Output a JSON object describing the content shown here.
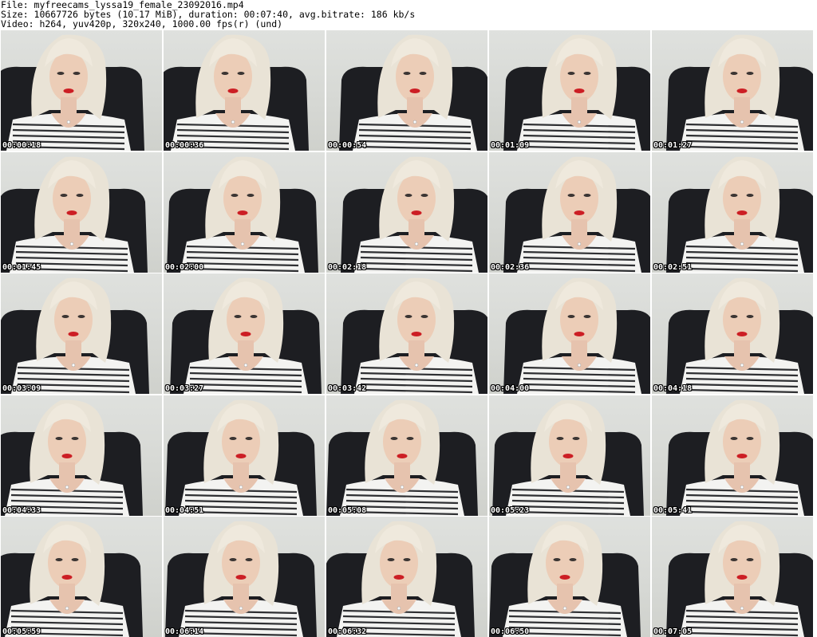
{
  "header": {
    "file_line": "File: myfreecams_lyssa19_female_23092016.mp4",
    "size_line": "Size: 10667726 bytes (10.17 MiB), duration: 00:07:40, avg.bitrate: 186 kb/s",
    "video_line": "Video: h264, yuv420p, 320x240, 1000.00 fps(r) (und)"
  },
  "thumbnails": [
    {
      "timestamp": "00:00:18"
    },
    {
      "timestamp": "00:00:36"
    },
    {
      "timestamp": "00:00:54"
    },
    {
      "timestamp": "00:01:09"
    },
    {
      "timestamp": "00:01:27"
    },
    {
      "timestamp": "00:01:45"
    },
    {
      "timestamp": "00:02:00"
    },
    {
      "timestamp": "00:02:18"
    },
    {
      "timestamp": "00:02:36"
    },
    {
      "timestamp": "00:02:51"
    },
    {
      "timestamp": "00:03:09"
    },
    {
      "timestamp": "00:03:27"
    },
    {
      "timestamp": "00:03:42"
    },
    {
      "timestamp": "00:04:00"
    },
    {
      "timestamp": "00:04:18"
    },
    {
      "timestamp": "00:04:33"
    },
    {
      "timestamp": "00:04:51"
    },
    {
      "timestamp": "00:05:08"
    },
    {
      "timestamp": "00:05:23"
    },
    {
      "timestamp": "00:05:41"
    },
    {
      "timestamp": "00:05:59"
    },
    {
      "timestamp": "00:06:14"
    },
    {
      "timestamp": "00:06:32"
    },
    {
      "timestamp": "00:06:50"
    },
    {
      "timestamp": "00:07:05"
    }
  ]
}
